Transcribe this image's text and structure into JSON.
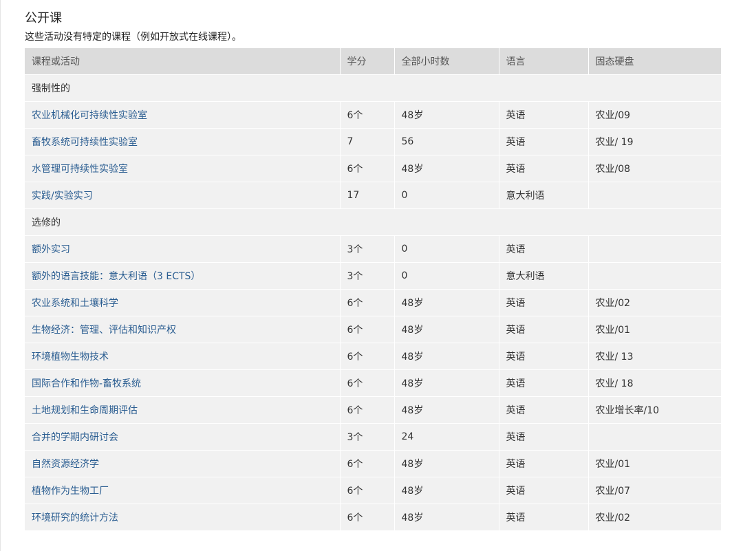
{
  "section": {
    "title": "公开课",
    "description": "这些活动没有特定的课程（例如开放式在线课程）。"
  },
  "table": {
    "headers": [
      "课程或活动",
      "学分",
      "全部小时数",
      "语言",
      "固态硬盘"
    ],
    "groups": [
      {
        "label": "强制性的",
        "rows": [
          [
            "农业机械化可持续性实验室",
            "6个",
            "48岁",
            "英语",
            "农业/09"
          ],
          [
            "畜牧系统可持续性实验室",
            "7",
            "56",
            "英语",
            "农业/ 19"
          ],
          [
            "水管理可持续性实验室",
            "6个",
            "48岁",
            "英语",
            "农业/08"
          ],
          [
            "实践/实验实习",
            "17",
            "0",
            "意大利语",
            ""
          ]
        ]
      },
      {
        "label": "选修的",
        "rows": [
          [
            "额外实习",
            "3个",
            "0",
            "英语",
            ""
          ],
          [
            "额外的语言技能：意大利语（3 ECTS）",
            "3个",
            "0",
            "意大利语",
            ""
          ],
          [
            "农业系统和土壤科学",
            "6个",
            "48岁",
            "英语",
            "农业/02"
          ],
          [
            "生物经济：管理、评估和知识产权",
            "6个",
            "48岁",
            "英语",
            "农业/01"
          ],
          [
            "环境植物生物技术",
            "6个",
            "48岁",
            "英语",
            "农业/ 13"
          ],
          [
            "国际合作和作物-畜牧系统",
            "6个",
            "48岁",
            "英语",
            "农业/ 18"
          ],
          [
            "土地规划和生命周期评估",
            "6个",
            "48岁",
            "英语",
            "农业增长率/10"
          ],
          [
            "合并的学期内研讨会",
            "3个",
            "24",
            "英语",
            ""
          ],
          [
            "自然资源经济学",
            "6个",
            "48岁",
            "英语",
            "农业/01"
          ],
          [
            "植物作为生物工厂",
            "6个",
            "48岁",
            "英语",
            "农业/07"
          ],
          [
            "环境研究的统计方法",
            "6个",
            "48岁",
            "英语",
            "农业/02"
          ]
        ]
      }
    ]
  }
}
